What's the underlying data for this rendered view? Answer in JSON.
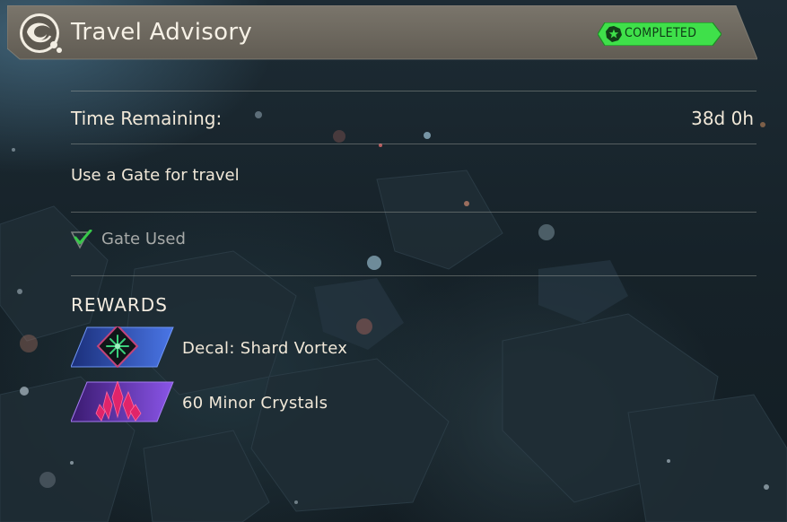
{
  "header": {
    "title": "Travel Advisory",
    "status_badge": "COMPLETED",
    "emblem_icon": "swirl-emblem-icon"
  },
  "time": {
    "label": "Time Remaining:",
    "value": "38d 0h"
  },
  "objective": {
    "text": "Use a Gate for travel"
  },
  "checklist": [
    {
      "label": "Gate Used",
      "done": true
    }
  ],
  "rewards": {
    "heading": "REWARDS",
    "items": [
      {
        "label": "Decal: Shard Vortex",
        "icon": "decal-shard-vortex-icon",
        "tier_color": "#3b5fd0"
      },
      {
        "label": "60 Minor Crystals",
        "icon": "minor-crystals-icon",
        "tier_color": "#7a3fd0"
      }
    ]
  },
  "colors": {
    "header_bar": "#6f6a60",
    "badge_green": "#3fe04a",
    "check_green": "#38c84a",
    "text": "#f1e8d8"
  }
}
